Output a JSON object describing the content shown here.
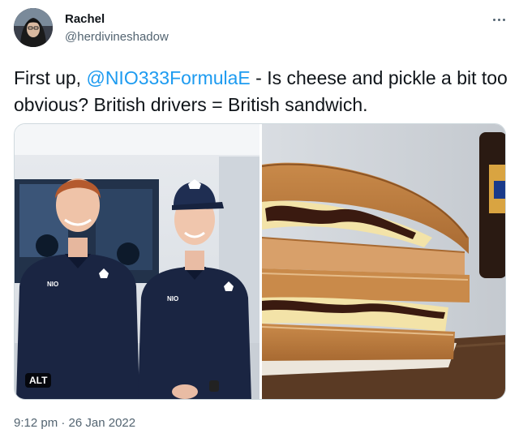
{
  "author": {
    "display_name": "Rachel",
    "handle": "@herdivineshadow"
  },
  "tweet": {
    "text_prefix": "First up, ",
    "mention": "@NIO333FormulaE",
    "text_suffix": " - Is cheese and pickle a bit too obvious? British drivers = British sandwich.",
    "timestamp": "9:12 pm · 26 Jan 2022"
  },
  "media": {
    "alt_badge": "ALT",
    "shirt_logo_text": "NIO"
  },
  "colors": {
    "accent": "#1d9bf0",
    "text": "#0f1419",
    "muted": "#536471"
  },
  "icons": {
    "more": "more-horizontal-icon"
  }
}
